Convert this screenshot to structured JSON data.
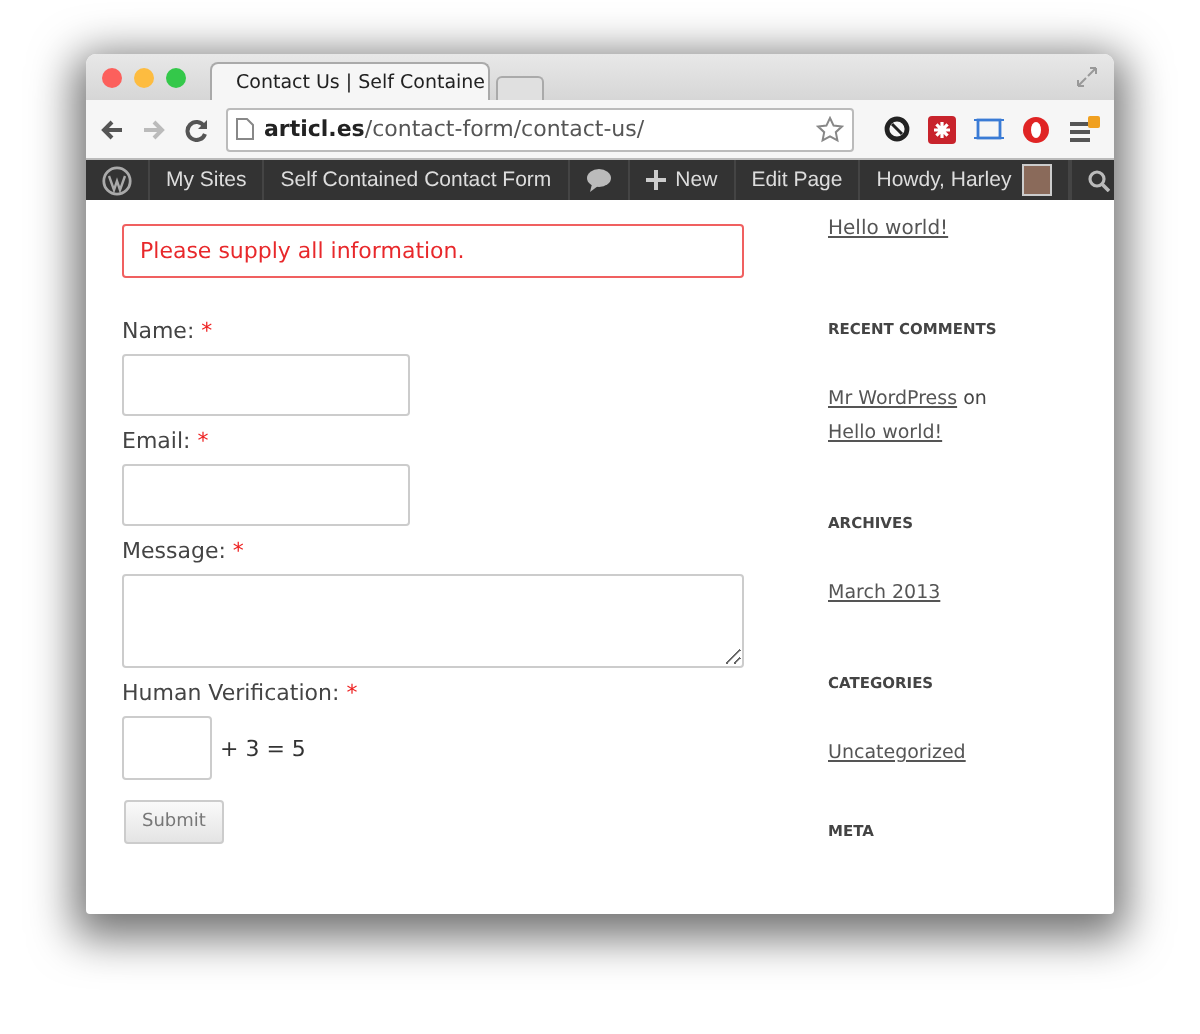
{
  "browser": {
    "tab_title": "Contact Us | Self Containe",
    "url_domain": "articl.es",
    "url_path": "/contact-form/contact-us/"
  },
  "admin_bar": [
    {
      "kind": "logo"
    },
    {
      "kind": "text",
      "label": "My Sites"
    },
    {
      "kind": "text",
      "label": "Self Contained Contact Form"
    },
    {
      "kind": "comments"
    },
    {
      "kind": "new",
      "label": "New"
    },
    {
      "kind": "text",
      "label": "Edit Page"
    },
    {
      "kind": "account",
      "label": "Howdy, Harley"
    },
    {
      "kind": "search"
    }
  ],
  "form": {
    "error": "Please supply all information.",
    "fields": [
      {
        "kind": "input",
        "label": "Name:",
        "required": "*"
      },
      {
        "kind": "input",
        "label": "Email:",
        "required": "*"
      },
      {
        "kind": "textarea",
        "label": "Message:",
        "required": "*"
      },
      {
        "kind": "captcha",
        "label": "Human Verification:",
        "required": "*",
        "suffix": "+ 3 = 5"
      }
    ],
    "submit": "Submit"
  },
  "sidebar": {
    "top_link": "Hello world!",
    "widgets": [
      {
        "title": "RECENT COMMENTS",
        "kind": "comment",
        "author": "Mr WordPress",
        "joiner": "on",
        "post": "Hello world!"
      },
      {
        "title": "ARCHIVES",
        "kind": "link",
        "link": "March 2013"
      },
      {
        "title": "CATEGORIES",
        "kind": "link",
        "link": "Uncategorized"
      },
      {
        "title": "META",
        "kind": "title"
      }
    ]
  }
}
